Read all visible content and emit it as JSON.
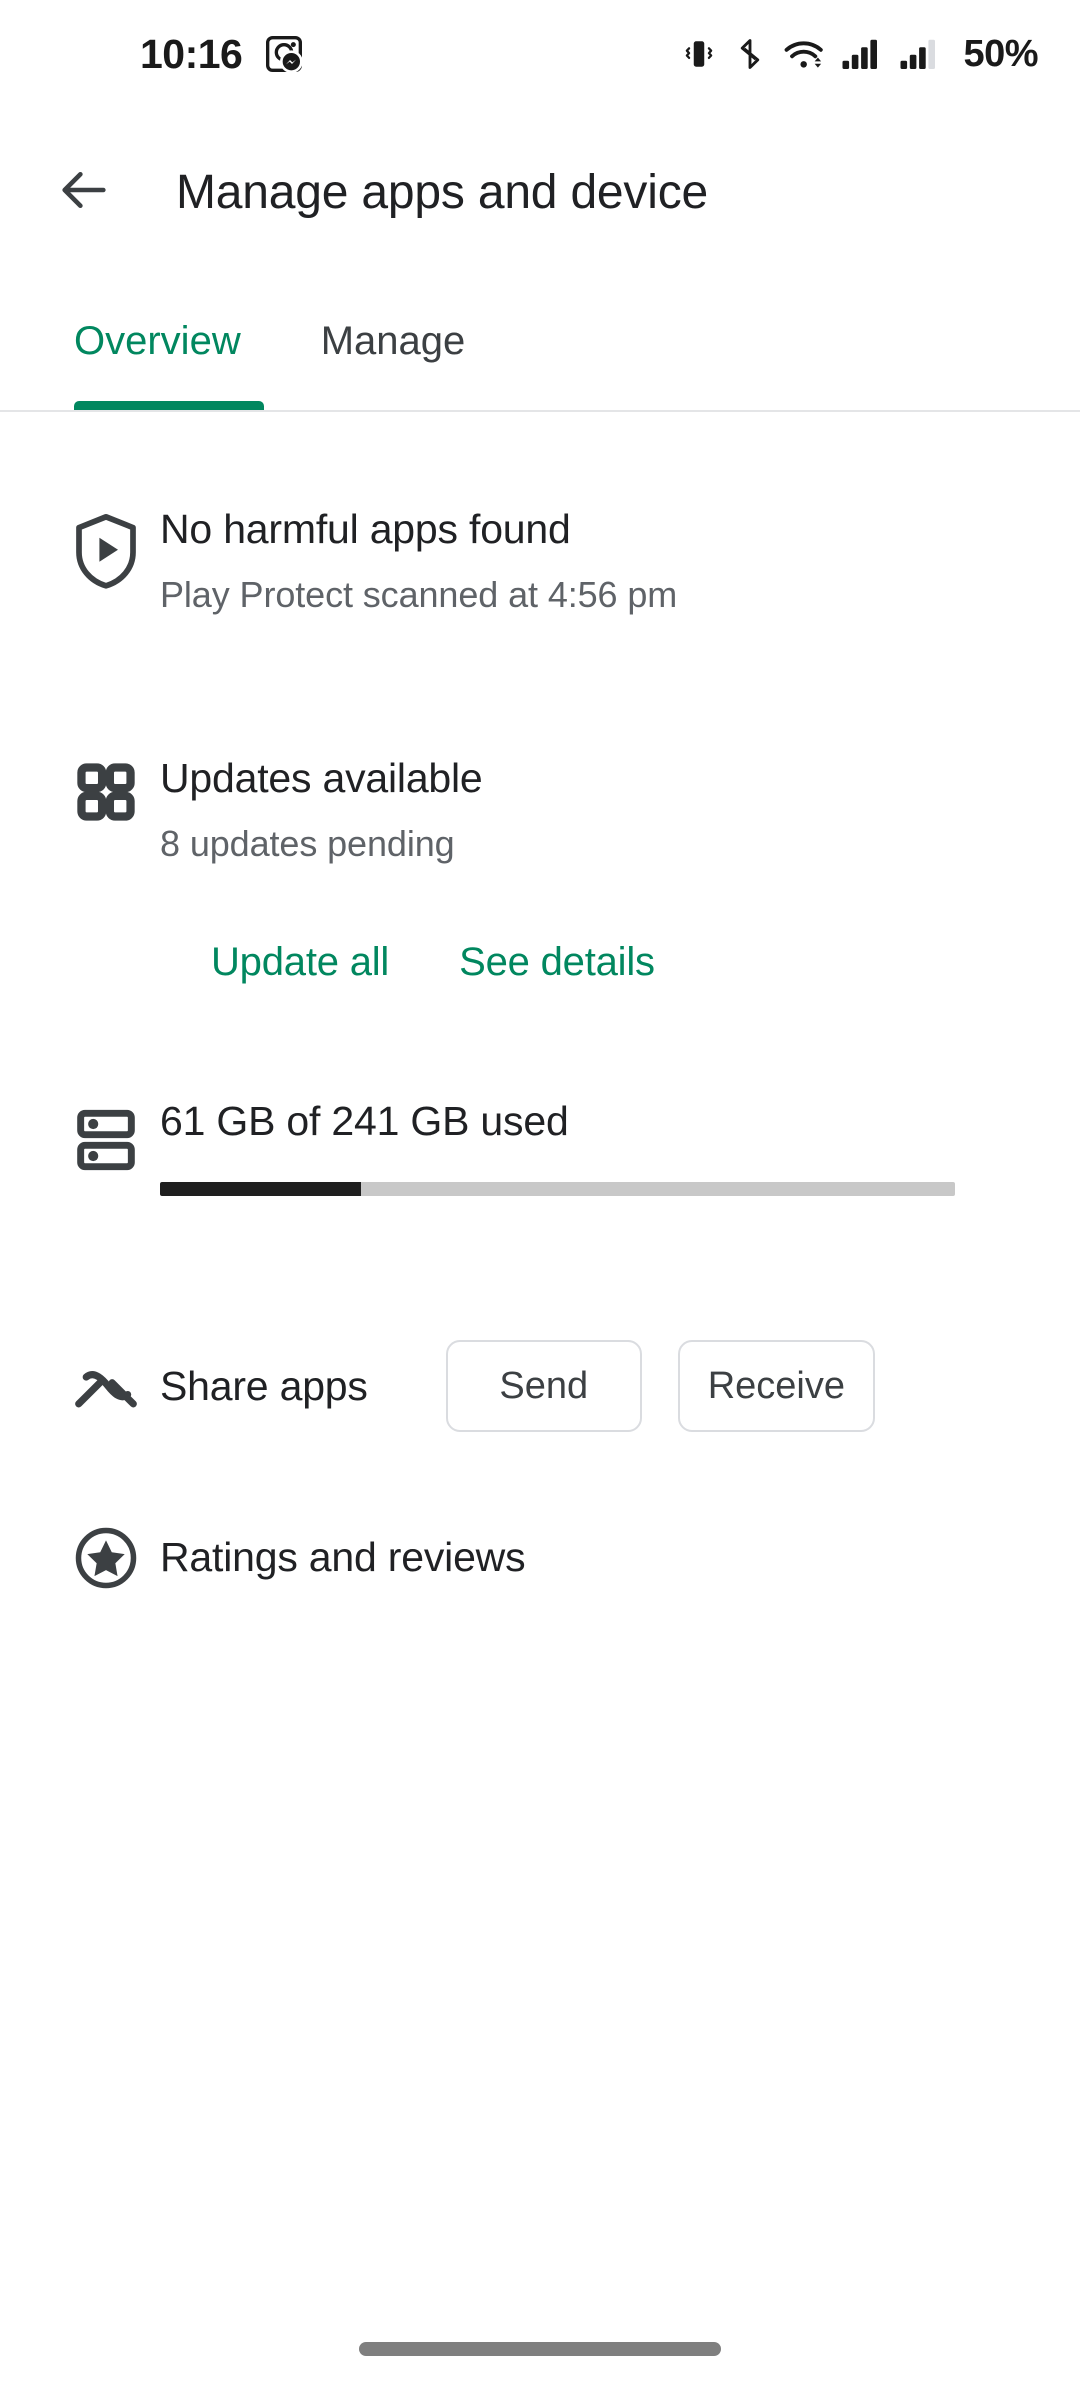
{
  "status_bar": {
    "time": "10:16",
    "battery_percent": "50%",
    "icons": [
      "messenger-notification-icon",
      "vibrate-icon",
      "bluetooth-icon",
      "wifi-icon",
      "signal-sim1-icon",
      "signal-sim2-icon"
    ]
  },
  "app_bar": {
    "back_icon": "arrow-back-icon",
    "title": "Manage apps and device"
  },
  "tabs": {
    "active_index": 0,
    "items": [
      {
        "label": "Overview"
      },
      {
        "label": "Manage"
      }
    ],
    "accent_color": "#01875f"
  },
  "sections": {
    "play_protect": {
      "icon": "play-protect-shield-icon",
      "title": "No harmful apps found",
      "subtitle": "Play Protect scanned at 4:56 pm"
    },
    "updates": {
      "icon": "apps-grid-icon",
      "title": "Updates available",
      "subtitle": "8 updates pending",
      "update_all_label": "Update all",
      "see_details_label": "See details"
    },
    "storage": {
      "icon": "storage-icon",
      "title": "61 GB of 241 GB used",
      "used_gb": 61,
      "total_gb": 241,
      "percent_used": 25
    },
    "share_apps": {
      "icon": "nearby-share-icon",
      "label": "Share apps",
      "send_label": "Send",
      "receive_label": "Receive"
    },
    "ratings": {
      "icon": "star-circle-icon",
      "label": "Ratings and reviews"
    }
  },
  "navigation": {
    "gesture_pill": "home-gesture-pill"
  }
}
